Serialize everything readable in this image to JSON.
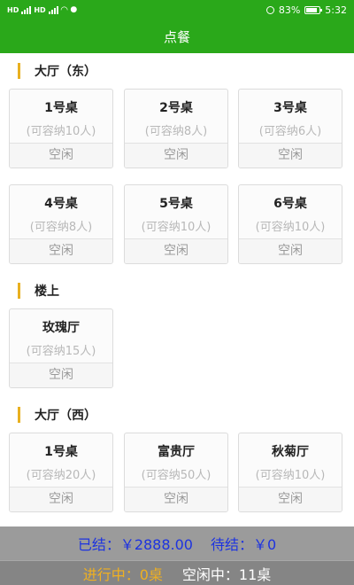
{
  "status_bar": {
    "battery": "83%",
    "battery_level": 0.83,
    "time": "5:32",
    "network_a": "HD",
    "network_b": "HD"
  },
  "header": {
    "title": "点餐"
  },
  "sections": [
    {
      "title": "大厅（东）",
      "tables": [
        {
          "name": "1号桌",
          "capacity": "(可容纳10人)",
          "status": "空闲"
        },
        {
          "name": "2号桌",
          "capacity": "(可容纳8人)",
          "status": "空闲"
        },
        {
          "name": "3号桌",
          "capacity": "(可容纳6人)",
          "status": "空闲"
        },
        {
          "name": "4号桌",
          "capacity": "(可容纳8人)",
          "status": "空闲"
        },
        {
          "name": "5号桌",
          "capacity": "(可容纳10人)",
          "status": "空闲"
        },
        {
          "name": "6号桌",
          "capacity": "(可容纳10人)",
          "status": "空闲"
        }
      ]
    },
    {
      "title": "楼上",
      "tables": [
        {
          "name": "玫瑰厅",
          "capacity": "(可容纳15人)",
          "status": "空闲"
        }
      ]
    },
    {
      "title": "大厅（西）",
      "tables": [
        {
          "name": "1号桌",
          "capacity": "(可容纳20人)",
          "status": "空闲"
        },
        {
          "name": "富贵厅",
          "capacity": "(可容纳50人)",
          "status": "空闲"
        },
        {
          "name": "秋菊厅",
          "capacity": "(可容纳10人)",
          "status": "空闲"
        }
      ]
    }
  ],
  "summary": {
    "settled": "已结：￥2888.00",
    "pending": "待结：￥0",
    "in_progress": "进行中：0桌",
    "idle": "空闲中：11桌"
  },
  "colors": {
    "brand_green": "#2aa81a",
    "section_accent": "#e8b020",
    "summary_blue": "#1d33e0",
    "running_orange": "#f0b020"
  }
}
